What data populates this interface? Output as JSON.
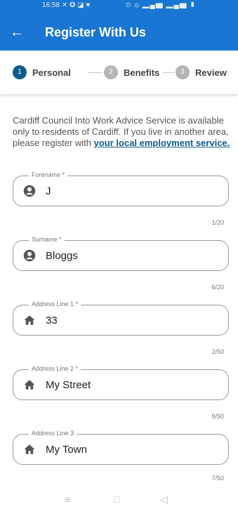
{
  "status_bar": {
    "time": "16:58",
    "left_icons": "✕ ✪ ◪ ♥",
    "right_icons": "⏲ ⊜ ▂▄▆ ▂▄▆ ▮"
  },
  "app_bar": {
    "title": "Register With Us",
    "back_icon": "arrow-left-icon"
  },
  "stepper": {
    "steps": [
      {
        "number": "1",
        "label": "Personal",
        "active": true
      },
      {
        "number": "2",
        "label": "Benefits",
        "active": false
      },
      {
        "number": "3",
        "label": "Review",
        "active": false
      }
    ],
    "active_color": "#0d5c8c",
    "inactive_color": "#b5b5b5"
  },
  "intro": {
    "text": "Cardiff Council Into Work Advice Service is available only to residents of Cardiff. If you live in another area, please register with ",
    "link": "your local employment service."
  },
  "fields": [
    {
      "label": "Forename *",
      "value": "J",
      "counter": "1/20",
      "icon": "account-circle-icon"
    },
    {
      "label": "Surname *",
      "value": "Bloggs",
      "counter": "6/20",
      "icon": "account-circle-icon"
    },
    {
      "label": "Address Line 1 *",
      "value": "33",
      "counter": "2/50",
      "icon": "home-icon"
    },
    {
      "label": "Address Line 2 *",
      "value": "My Street",
      "counter": "9/50",
      "icon": "home-icon"
    },
    {
      "label": "Address Line 3",
      "value": "My Town",
      "counter": "7/50",
      "icon": "home-icon"
    }
  ],
  "nav_bar": {
    "menu": "≡",
    "home": "□",
    "back": "◁"
  }
}
